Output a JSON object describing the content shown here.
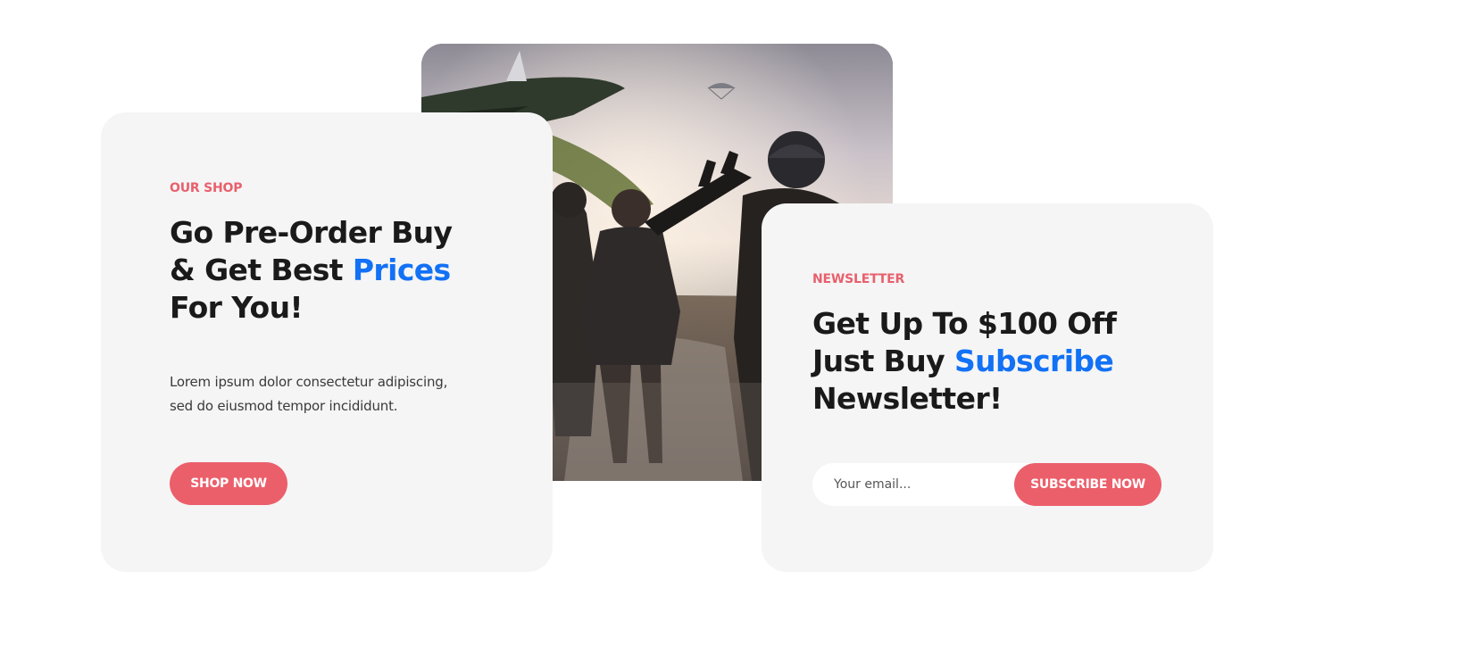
{
  "shop": {
    "eyebrow": "OUR SHOP",
    "heading_line1": "Go Pre-Order Buy",
    "heading_line2_prefix": "& Get Best ",
    "heading_line2_accent": "Prices",
    "heading_line3": "For You!",
    "description_line1": "Lorem ipsum dolor consectetur adipiscing,",
    "description_line2": "sed do eiusmod tempor incididunt.",
    "button_label": "SHOP NOW"
  },
  "newsletter": {
    "eyebrow": "NEWSLETTER",
    "heading_line1": "Get Up To $100 Off",
    "heading_line2_prefix": "Just Buy ",
    "heading_line2_accent": "Subscribe",
    "heading_line3": "Newsletter!",
    "email_placeholder": "Your email...",
    "button_label": "SUBSCRIBE NOW"
  },
  "colors": {
    "accent_blue": "#1271f5",
    "accent_coral": "#eb5f6b",
    "card_background": "#f5f5f5"
  }
}
